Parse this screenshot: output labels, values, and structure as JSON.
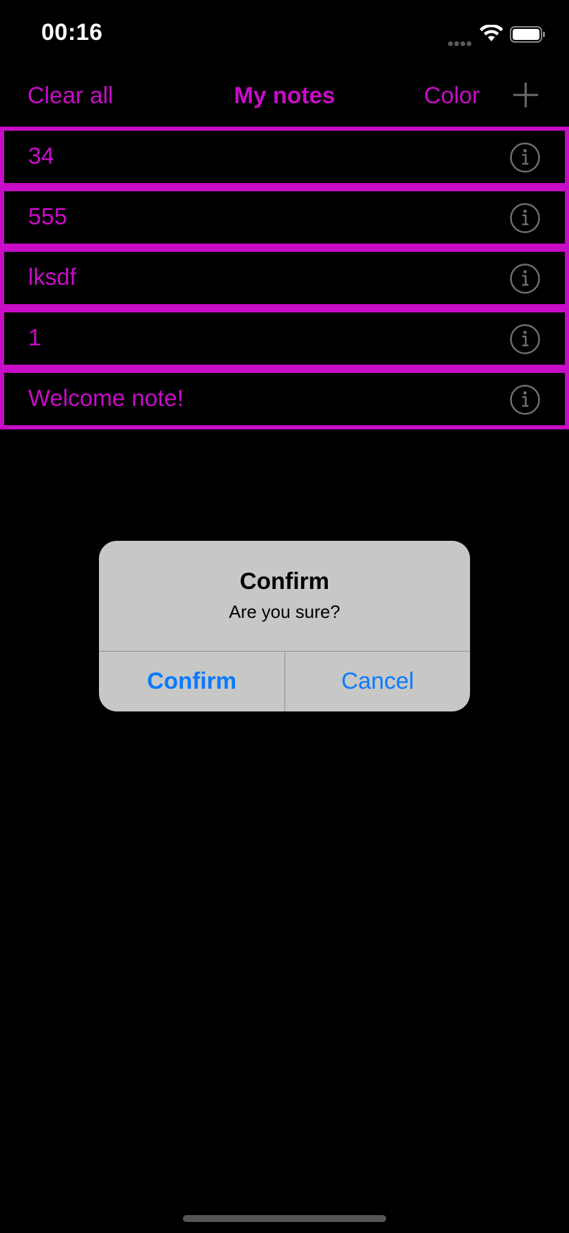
{
  "status_bar": {
    "time": "00:16"
  },
  "nav": {
    "clear_label": "Clear all",
    "title": "My notes",
    "color_label": "Color",
    "add_icon": "plus-icon"
  },
  "notes": [
    {
      "text": "34",
      "icon": "info-icon"
    },
    {
      "text": "555",
      "icon": "info-icon"
    },
    {
      "text": "lksdf",
      "icon": "info-icon"
    },
    {
      "text": "1",
      "icon": "info-icon"
    },
    {
      "text": "Welcome note!",
      "icon": "info-icon"
    }
  ],
  "alert": {
    "title": "Confirm",
    "message": "Are you sure?",
    "confirm_label": "Confirm",
    "cancel_label": "Cancel"
  },
  "colors": {
    "accent": "#c80cc8",
    "background": "#000000",
    "alert_background": "#c7c7c6",
    "alert_button": "#0a7aff",
    "info_icon": "#6e6e6e"
  }
}
